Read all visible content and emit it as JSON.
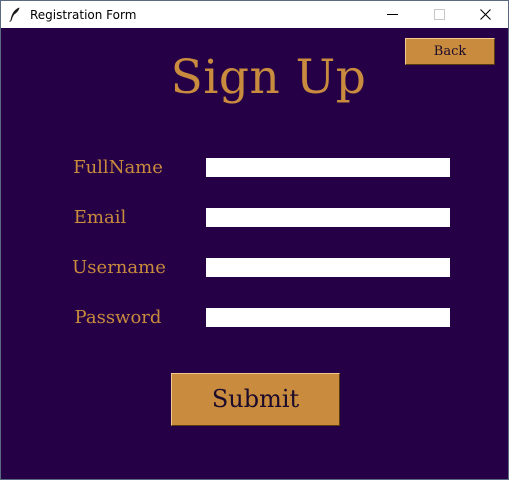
{
  "window": {
    "title": "Registration Form"
  },
  "header": {
    "back_label": "Back",
    "title": "Sign Up"
  },
  "form": {
    "fields": [
      {
        "label": "FullName",
        "value": ""
      },
      {
        "label": "Email",
        "value": ""
      },
      {
        "label": "Username",
        "value": ""
      },
      {
        "label": "Password",
        "value": ""
      }
    ],
    "submit_label": "Submit"
  },
  "icons": {
    "app": "feather-icon",
    "minimize": "minimize-icon",
    "maximize": "maximize-icon",
    "close": "close-icon"
  },
  "colors": {
    "background": "#250046",
    "accent": "#c98b3e",
    "field": "#ffffff"
  }
}
